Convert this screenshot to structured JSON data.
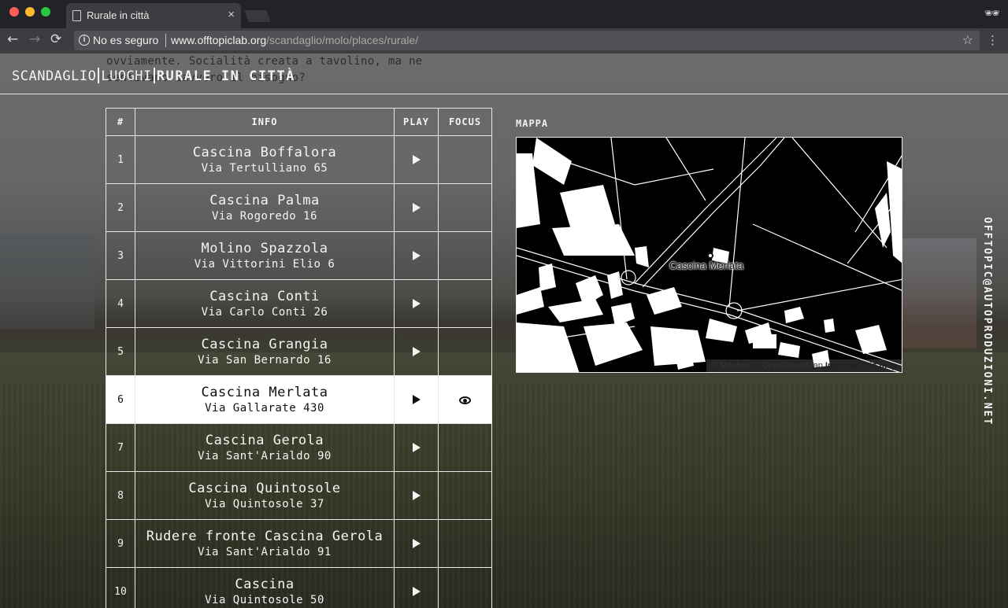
{
  "browser": {
    "tab_title": "Rurale in città",
    "tab_close": "×",
    "security_label": "No es seguro",
    "url_host": "www.offtopiclab.org",
    "url_path": "/scandaglio/molo/places/rurale/",
    "icons": {
      "back": "←",
      "forward": "→",
      "reload": "⟳",
      "star": "☆",
      "menu": "⋮",
      "info": "i",
      "incognito": "🕶"
    }
  },
  "page": {
    "ghost_text": "ovviamente. Socialità creata a tavolino, ma ne sentivano davvero il bisogno?",
    "breadcrumb": {
      "root": "SCANDAGLIO",
      "section": "LUOGHI",
      "current": "RURALE IN CITTÀ"
    },
    "table": {
      "headers": {
        "num": "#",
        "info": "INFO",
        "play": "PLAY",
        "focus": "FOCUS"
      },
      "rows": [
        {
          "num": "1",
          "name": "Cascina Boffalora",
          "address": "Via Tertulliano 65"
        },
        {
          "num": "2",
          "name": "Cascina Palma",
          "address": "Via Rogoredo 16"
        },
        {
          "num": "3",
          "name": "Molino Spazzola",
          "address": "Via Vittorini Elio 6"
        },
        {
          "num": "4",
          "name": "Cascina Conti",
          "address": "Via Carlo Conti 26"
        },
        {
          "num": "5",
          "name": "Cascina Grangia",
          "address": "Via San Bernardo 16"
        },
        {
          "num": "6",
          "name": "Cascina Merlata",
          "address": "Via Gallarate 430"
        },
        {
          "num": "7",
          "name": "Cascina Gerola",
          "address": "Via Sant'Arialdo 90"
        },
        {
          "num": "8",
          "name": "Cascina Quintosole",
          "address": "Via Quintosole 37"
        },
        {
          "num": "9",
          "name": "Rudere fronte Cascina Gerola",
          "address": "Via Sant'Arialdo 91"
        },
        {
          "num": "10",
          "name": "Cascina",
          "address": "Via Quintosole 50"
        }
      ]
    },
    "map": {
      "label": "MAPPA",
      "marker_label": "Cascina Merlata",
      "attribution_mapbox": "© Mapbox",
      "attribution_osm": "© OpenStreetMap",
      "attribution_improve": "Improve this map"
    },
    "vertical_credit": "OFFTOPIC@AUTOPRODUZIONI.NET"
  }
}
